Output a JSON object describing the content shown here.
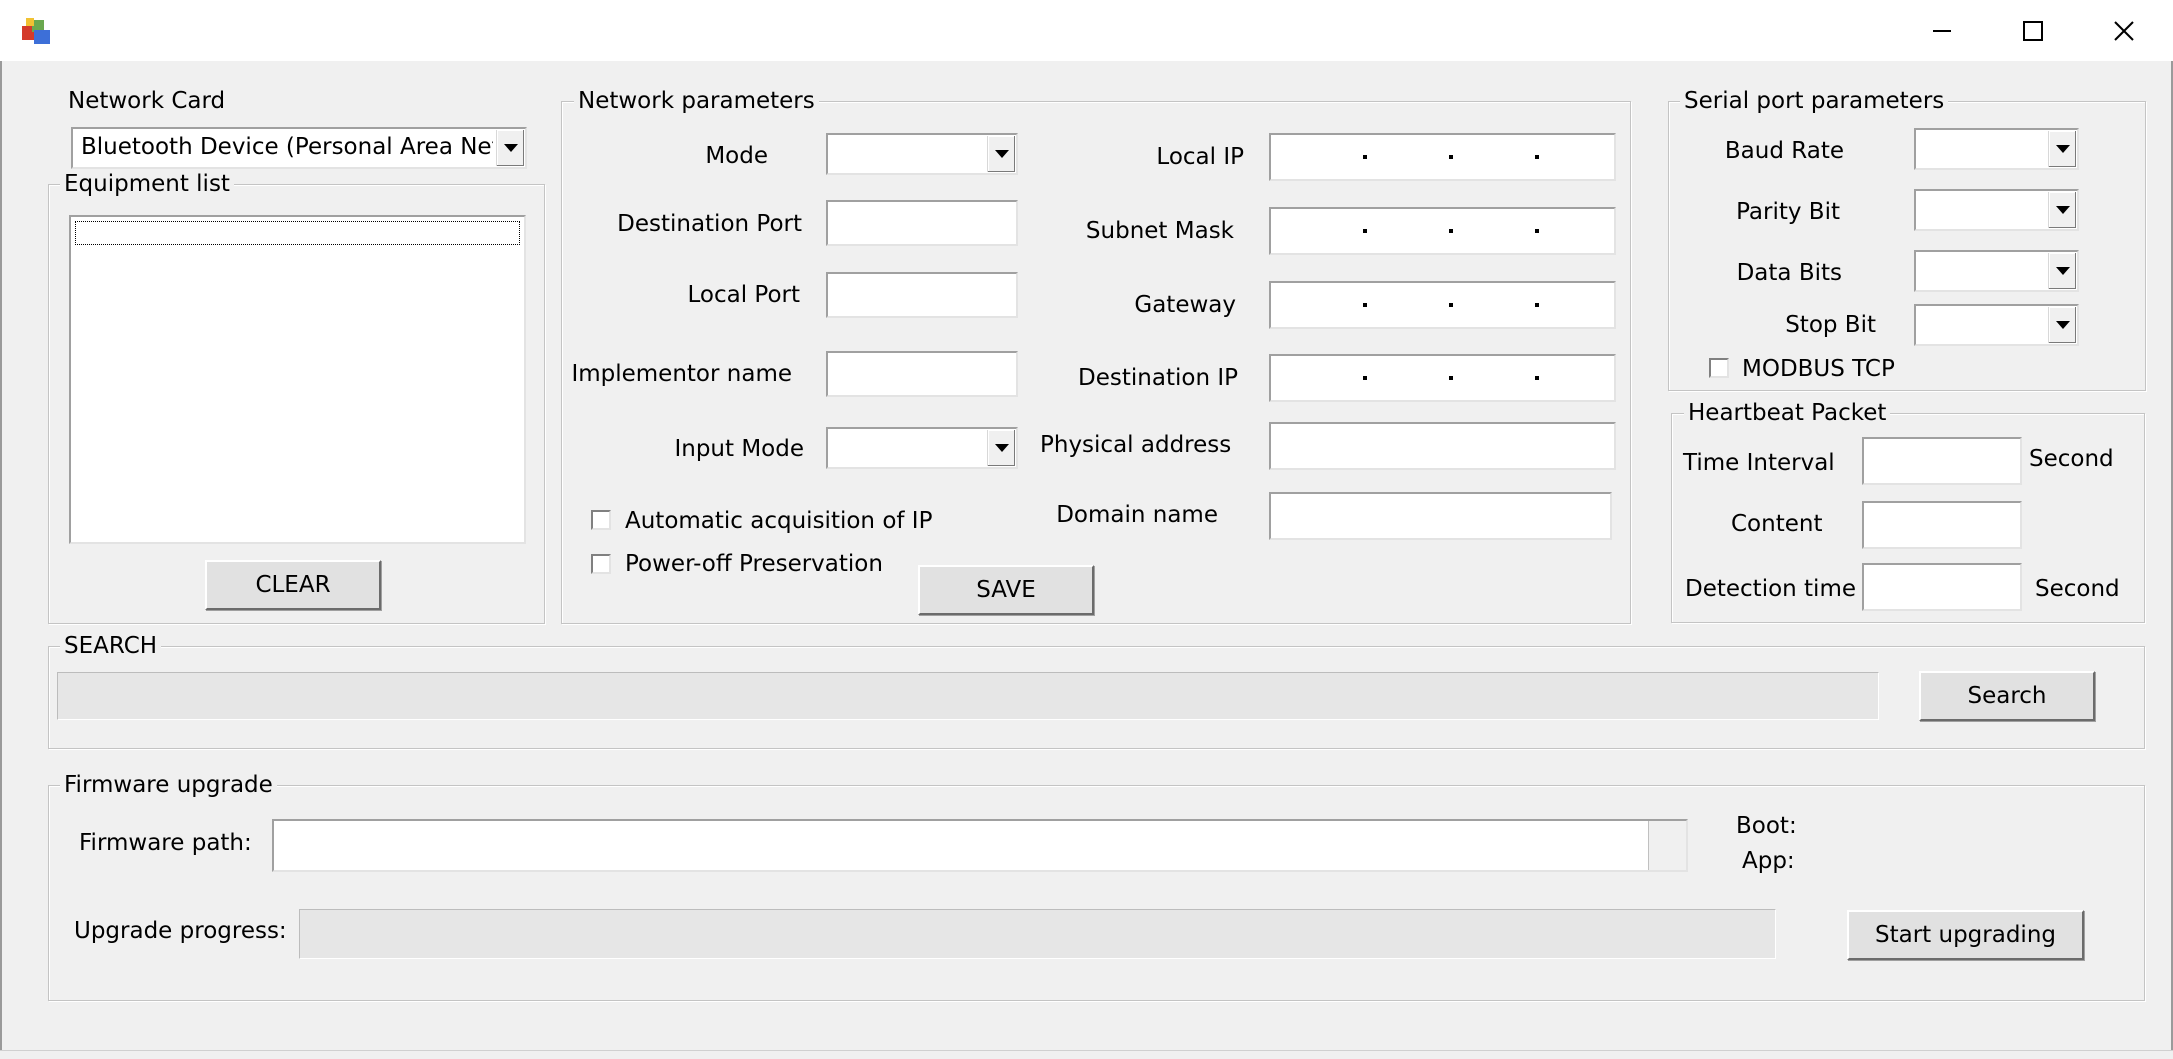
{
  "window": {
    "title": "",
    "controls": {
      "minimize": "─",
      "maximize": "☐",
      "close": "✕"
    }
  },
  "network_card": {
    "label": "Network Card",
    "selected": "Bluetooth Device (Personal Area Network)"
  },
  "equipment_list": {
    "legend": "Equipment list",
    "items": [],
    "clear_button": "CLEAR"
  },
  "network_parameters": {
    "legend": "Network parameters",
    "mode_label": "Mode",
    "mode_value": "",
    "destination_port_label": "Destination Port",
    "destination_port_value": "",
    "local_port_label": "Local Port",
    "local_port_value": "",
    "implementor_name_label": "Implementor name",
    "implementor_name_value": "",
    "input_mode_label": "Input Mode",
    "input_mode_value": "",
    "local_ip_label": "Local IP",
    "subnet_mask_label": "Subnet Mask",
    "gateway_label": "Gateway",
    "destination_ip_label": "Destination IP",
    "physical_address_label": "Physical address",
    "physical_address_value": "",
    "domain_name_label": "Domain name",
    "domain_name_value": "",
    "auto_ip_label": "Automatic acquisition of IP",
    "auto_ip_checked": false,
    "power_off_label": "Power-off Preservation",
    "power_off_checked": false,
    "save_button": "SAVE"
  },
  "serial_port": {
    "legend": "Serial port parameters",
    "baud_rate_label": "Baud Rate",
    "baud_rate_value": "",
    "parity_bit_label": "Parity Bit",
    "parity_bit_value": "",
    "data_bits_label": "Data Bits",
    "data_bits_value": "",
    "stop_bit_label": "Stop Bit",
    "stop_bit_value": "",
    "modbus_label": "MODBUS TCP",
    "modbus_checked": false
  },
  "heartbeat": {
    "legend": "Heartbeat Packet",
    "time_interval_label": "Time Interval",
    "time_interval_unit": "Second",
    "content_label": "Content",
    "detection_time_label": "Detection time",
    "detection_time_unit": "Second"
  },
  "search": {
    "legend": "SEARCH",
    "button": "Search",
    "progress": 0
  },
  "firmware": {
    "legend": "Firmware upgrade",
    "path_label": "Firmware path:",
    "path_value": "",
    "boot_label": "Boot:",
    "app_label": "App:",
    "progress_label": "Upgrade progress:",
    "progress": 0,
    "start_button": "Start upgrading"
  }
}
